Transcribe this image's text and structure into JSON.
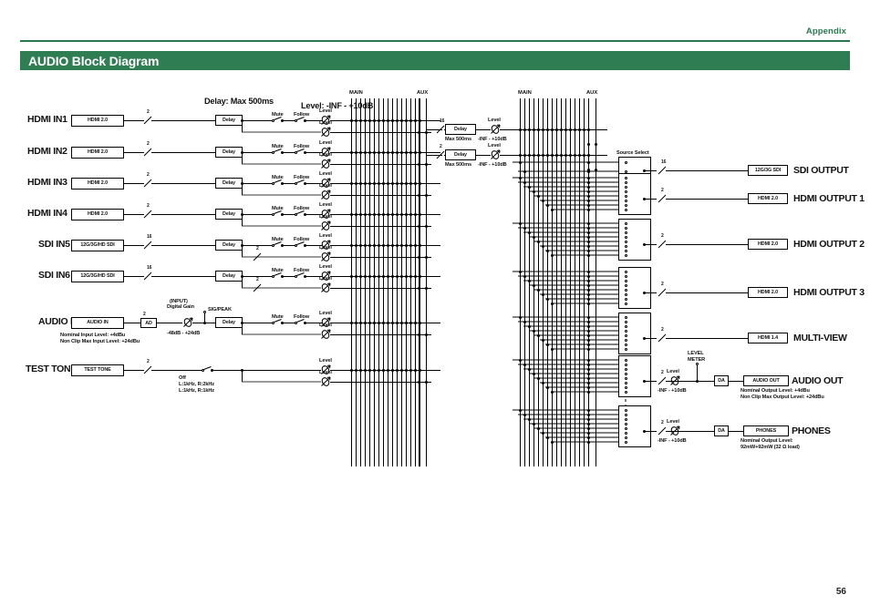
{
  "header": {
    "appendix": "Appendix",
    "title": "AUDIO Block Diagram",
    "page_number": "56",
    "accent_color": "#2f7d52"
  },
  "annotations": {
    "delay_max": "Delay: Max 500ms",
    "level_range_top": "Level: -INF - +10dB",
    "level_range": "-INF - +10dB",
    "max500": "Max 500ms",
    "bus_main": "MAIN",
    "bus_aux": "AUX",
    "mute": "Mute",
    "follow": "Follow",
    "level": "Level",
    "delay": "Delay",
    "source_select": "Source Select",
    "level_meter_l1": "LEVEL",
    "level_meter_l2": "METER",
    "sig_peak": "SIG/PEAK",
    "input_l1": "(INPUT)",
    "input_l2": "Digital Gain",
    "digital_gain_range": "-48dB - +24dB",
    "ad": "AD",
    "da": "DA",
    "off": "Off",
    "tone1": "L:1kHz, R:2kHz",
    "tone2": "L:1kHz, R:1kHz",
    "audio_in_note1": "Nominal Input Level: +4dBu",
    "audio_in_note2": "Non Clip Max Input Level: +24dBu",
    "audio_out_note1": "Nominal Output Level: +4dBu",
    "audio_out_note2": "Non Clip Max Output Level: +24dBu",
    "phones_note1": "Nominal Output Level:",
    "phones_note2": "92mW+92mW (32 Ω load)"
  },
  "inputs": [
    {
      "name": "HDMI IN1",
      "connector": "HDMI 2.0",
      "channels": "2",
      "row": 0
    },
    {
      "name": "HDMI IN2",
      "connector": "HDMI 2.0",
      "channels": "2",
      "row": 1
    },
    {
      "name": "HDMI IN3",
      "connector": "HDMI 2.0",
      "channels": "2",
      "row": 2
    },
    {
      "name": "HDMI IN4",
      "connector": "HDMI 2.0",
      "channels": "2",
      "row": 3
    },
    {
      "name": "SDI IN5",
      "connector": "12G/3G/HD SDI",
      "channels": "16",
      "row": 4
    },
    {
      "name": "SDI IN6",
      "connector": "12G/3G/HD SDI",
      "channels": "16",
      "row": 5
    },
    {
      "name": "AUDIO IN",
      "connector": "AUDIO IN",
      "channels": "2",
      "row": 6
    }
  ],
  "sub_channels": {
    "sdi5": "2",
    "sdi6": "2"
  },
  "test_tone": {
    "name": "TEST TONE",
    "connector": "TEST TONE",
    "channels": "2"
  },
  "mid_returns": [
    {
      "channels": "16",
      "delay": "Delay",
      "max": "Max 500ms",
      "level": "Level",
      "range": "-INF - +10dB"
    },
    {
      "channels": "2",
      "delay": "Delay",
      "max": "Max 500ms",
      "level": "Level",
      "range": "-INF - +10dB"
    }
  ],
  "outputs": [
    {
      "name": "SDI OUTPUT",
      "connector": "12G/3G SDI",
      "channels": "16",
      "selector": "small"
    },
    {
      "name": "HDMI OUTPUT 1",
      "connector": "HDMI 2.0",
      "channels": "2",
      "selector": "large"
    },
    {
      "name": "HDMI OUTPUT 2",
      "connector": "HDMI 2.0",
      "channels": "2",
      "selector": "large"
    },
    {
      "name": "HDMI OUTPUT 3",
      "connector": "HDMI 2.0",
      "channels": "2",
      "selector": "large"
    },
    {
      "name": "MULTI-VIEW",
      "connector": "HDMI 1.4",
      "channels": "2",
      "selector": "large"
    },
    {
      "name": "AUDIO OUT",
      "connector": "AUDIO OUT",
      "channels": "2",
      "selector": "large"
    },
    {
      "name": "PHONES",
      "connector": "PHONES",
      "channels": "2",
      "selector": "large"
    }
  ]
}
